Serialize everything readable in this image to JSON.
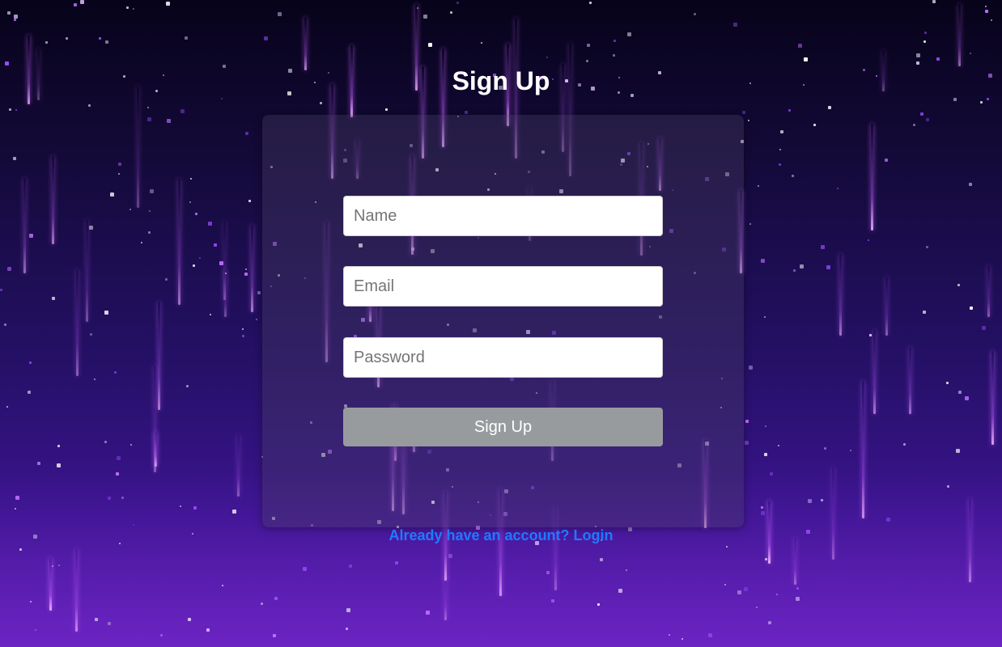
{
  "page": {
    "title": "Sign Up"
  },
  "form": {
    "name_placeholder": "Name",
    "name_value": "",
    "email_placeholder": "Email",
    "email_value": "",
    "password_placeholder": "Password",
    "password_value": "",
    "submit_label": "Sign Up"
  },
  "footer": {
    "login_link": "Already have an account? Login"
  },
  "colors": {
    "background_top": "#07031a",
    "background_bottom": "#5a1cb0",
    "accent_streak": "#be5aff",
    "submit_button": "#989b9d",
    "link": "#1e7bff"
  }
}
